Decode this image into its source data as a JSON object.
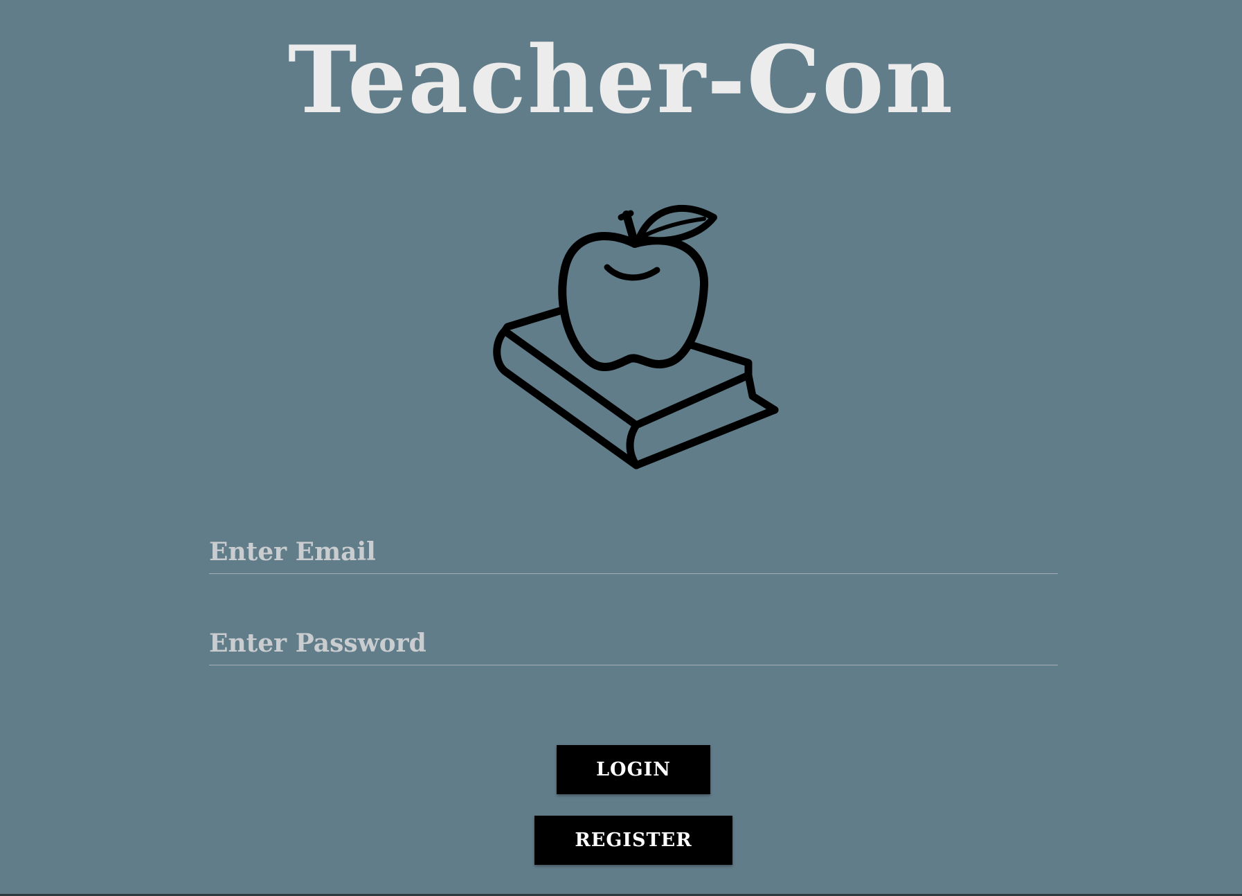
{
  "app": {
    "title": "Teacher-Con"
  },
  "logo": {
    "icon": "apple-on-book-icon"
  },
  "form": {
    "email_placeholder": "Enter Email",
    "email_value": "",
    "password_placeholder": "Enter Password",
    "password_value": ""
  },
  "buttons": {
    "login_label": "LOGIN",
    "register_label": "REGISTER"
  },
  "colors": {
    "background": "#627d8a",
    "title": "#ececec",
    "button_bg": "#000000",
    "button_text": "#ffffff",
    "placeholder": "#c9cdcf"
  }
}
